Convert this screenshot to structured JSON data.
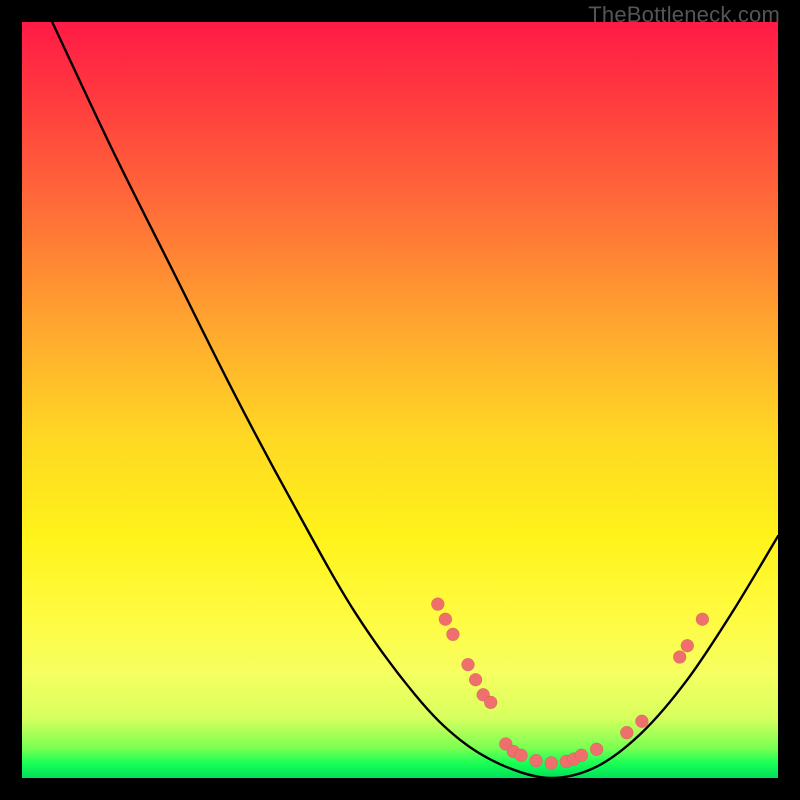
{
  "attribution": "TheBottleneck.com",
  "colors": {
    "marker": "#ee6f6b",
    "curve": "#000000"
  },
  "chart_data": {
    "type": "line",
    "title": "",
    "xlabel": "",
    "ylabel": "",
    "xlim": [
      0,
      100
    ],
    "ylim": [
      0,
      100
    ],
    "grid": false,
    "legend": false,
    "curve_points": [
      {
        "x": 4,
        "y": 100
      },
      {
        "x": 12,
        "y": 83
      },
      {
        "x": 20,
        "y": 67
      },
      {
        "x": 28,
        "y": 51
      },
      {
        "x": 36,
        "y": 36
      },
      {
        "x": 44,
        "y": 22
      },
      {
        "x": 52,
        "y": 11
      },
      {
        "x": 58,
        "y": 5
      },
      {
        "x": 64,
        "y": 1.5
      },
      {
        "x": 70,
        "y": 0
      },
      {
        "x": 76,
        "y": 1.5
      },
      {
        "x": 82,
        "y": 6
      },
      {
        "x": 88,
        "y": 13
      },
      {
        "x": 94,
        "y": 22
      },
      {
        "x": 100,
        "y": 32
      }
    ],
    "markers": [
      {
        "x": 55,
        "y": 23
      },
      {
        "x": 56,
        "y": 21
      },
      {
        "x": 57,
        "y": 19
      },
      {
        "x": 59,
        "y": 15
      },
      {
        "x": 60,
        "y": 13
      },
      {
        "x": 61,
        "y": 11
      },
      {
        "x": 62,
        "y": 10
      },
      {
        "x": 64,
        "y": 4.5
      },
      {
        "x": 65,
        "y": 3.5
      },
      {
        "x": 66,
        "y": 3
      },
      {
        "x": 68,
        "y": 2.3
      },
      {
        "x": 70,
        "y": 2
      },
      {
        "x": 72,
        "y": 2.2
      },
      {
        "x": 73,
        "y": 2.5
      },
      {
        "x": 74,
        "y": 3
      },
      {
        "x": 76,
        "y": 3.8
      },
      {
        "x": 80,
        "y": 6
      },
      {
        "x": 82,
        "y": 7.5
      },
      {
        "x": 87,
        "y": 16
      },
      {
        "x": 88,
        "y": 17.5
      },
      {
        "x": 90,
        "y": 21
      }
    ]
  }
}
